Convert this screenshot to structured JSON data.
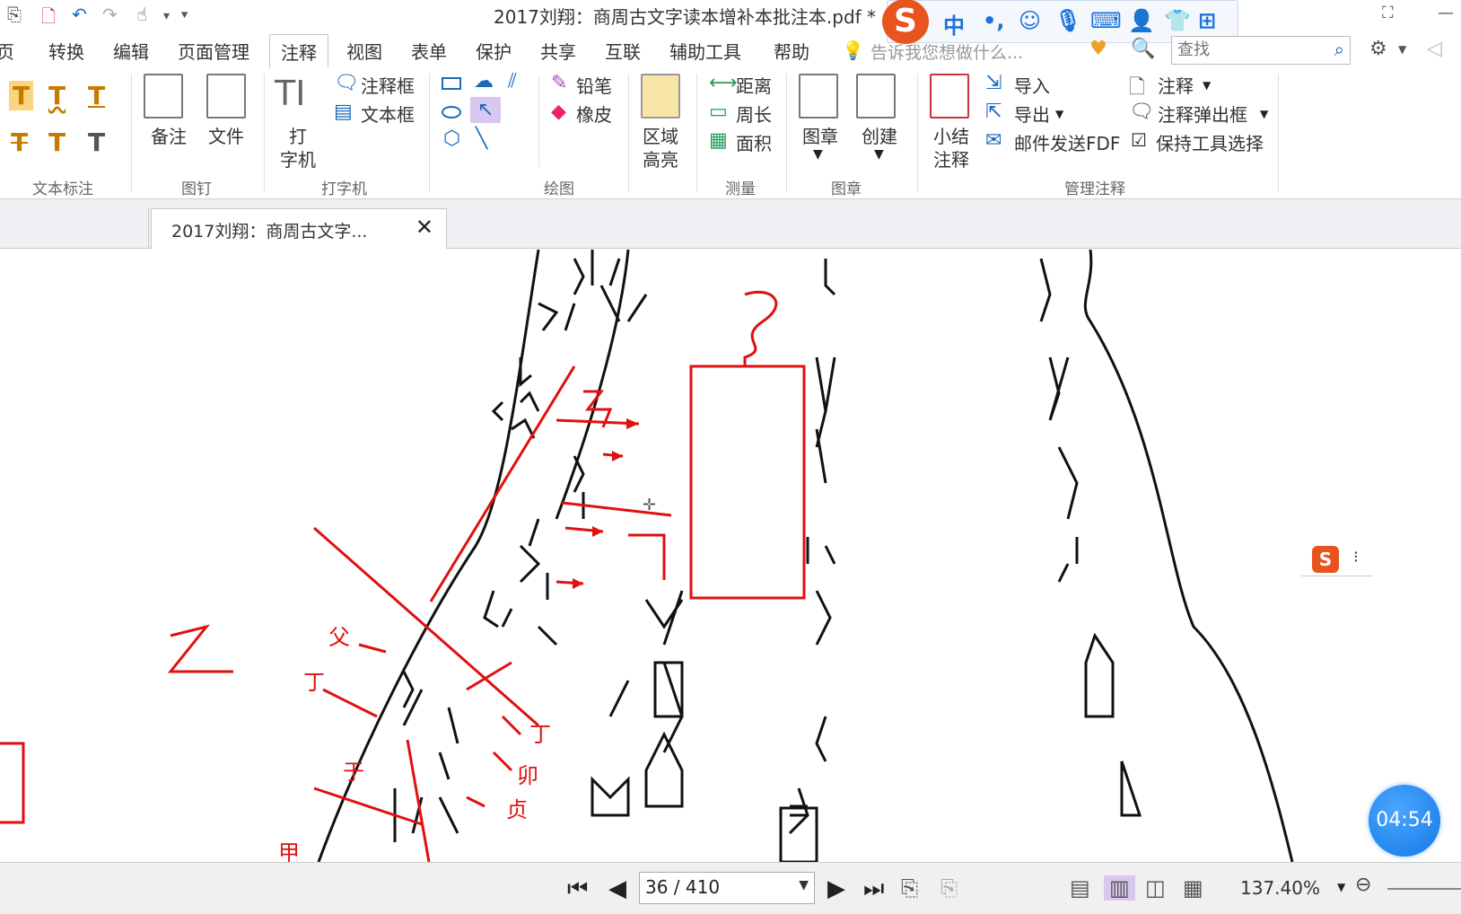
{
  "window": {
    "title": "2017刘翔：商周古文字读本增补本批注本.pdf *",
    "ime_items": [
      "S",
      "中",
      "•,",
      "☺",
      "🎙",
      "⌨",
      "👤",
      "👕",
      "⊞"
    ]
  },
  "menu": {
    "items": [
      "页",
      "转换",
      "编辑",
      "页面管理",
      "注释",
      "视图",
      "表单",
      "保护",
      "共享",
      "互联",
      "辅助工具",
      "帮助"
    ],
    "active": "注释",
    "tell_me": "告诉我您想做什么...",
    "search_placeholder": "查找"
  },
  "ribbon": {
    "groups": {
      "text_markup": "文本标注",
      "pin": "图钉",
      "typewriter": "打字机",
      "drawing": "绘图",
      "measure": "测量",
      "stamp": "图章",
      "manage": "管理注释"
    },
    "buttons": {
      "note": "备注",
      "file": "文件",
      "typewriter_line1": "打",
      "typewriter_line2": "字机",
      "callout": "注释框",
      "textbox": "文本框",
      "pencil": "铅笔",
      "eraser": "橡皮",
      "area_highlight_line1": "区域",
      "area_highlight_line2": "高亮",
      "distance": "距离",
      "perimeter": "周长",
      "area": "面积",
      "stamp": "图章",
      "create": "创建",
      "summary_line1": "小结",
      "summary_line2": "注释",
      "import": "导入",
      "export": "导出",
      "email_fdf": "邮件发送FDF",
      "annotation": "注释",
      "annot_popup": "注释弹出框",
      "keep_tool": "保持工具选择"
    }
  },
  "tabs": {
    "doc_title": "2017刘翔：商周古文字..."
  },
  "document": {
    "timer": "04:54",
    "red_annotations": [
      "父",
      "丁",
      "丁",
      "卯",
      "于",
      "贞",
      "甲"
    ]
  },
  "status": {
    "page": "36 / 410",
    "zoom": "137.40%"
  }
}
